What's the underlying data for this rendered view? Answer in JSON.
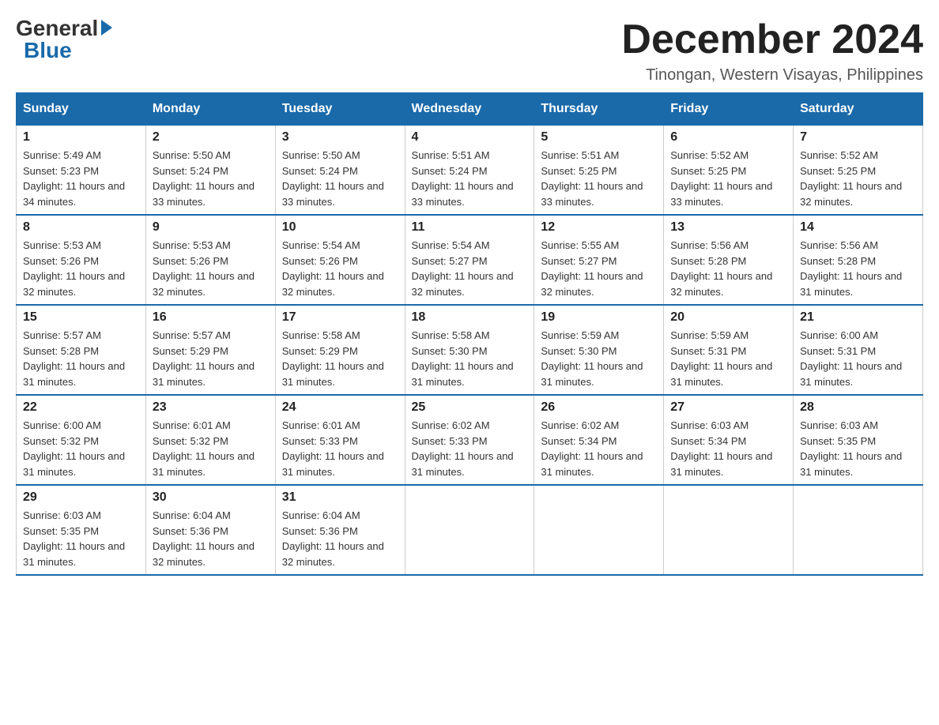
{
  "header": {
    "logo": {
      "general": "General",
      "blue": "Blue"
    },
    "title": "December 2024",
    "location": "Tinongan, Western Visayas, Philippines"
  },
  "calendar": {
    "days_of_week": [
      "Sunday",
      "Monday",
      "Tuesday",
      "Wednesday",
      "Thursday",
      "Friday",
      "Saturday"
    ],
    "weeks": [
      [
        {
          "day": "1",
          "sunrise": "5:49 AM",
          "sunset": "5:23 PM",
          "daylight": "11 hours and 34 minutes."
        },
        {
          "day": "2",
          "sunrise": "5:50 AM",
          "sunset": "5:24 PM",
          "daylight": "11 hours and 33 minutes."
        },
        {
          "day": "3",
          "sunrise": "5:50 AM",
          "sunset": "5:24 PM",
          "daylight": "11 hours and 33 minutes."
        },
        {
          "day": "4",
          "sunrise": "5:51 AM",
          "sunset": "5:24 PM",
          "daylight": "11 hours and 33 minutes."
        },
        {
          "day": "5",
          "sunrise": "5:51 AM",
          "sunset": "5:25 PM",
          "daylight": "11 hours and 33 minutes."
        },
        {
          "day": "6",
          "sunrise": "5:52 AM",
          "sunset": "5:25 PM",
          "daylight": "11 hours and 33 minutes."
        },
        {
          "day": "7",
          "sunrise": "5:52 AM",
          "sunset": "5:25 PM",
          "daylight": "11 hours and 32 minutes."
        }
      ],
      [
        {
          "day": "8",
          "sunrise": "5:53 AM",
          "sunset": "5:26 PM",
          "daylight": "11 hours and 32 minutes."
        },
        {
          "day": "9",
          "sunrise": "5:53 AM",
          "sunset": "5:26 PM",
          "daylight": "11 hours and 32 minutes."
        },
        {
          "day": "10",
          "sunrise": "5:54 AM",
          "sunset": "5:26 PM",
          "daylight": "11 hours and 32 minutes."
        },
        {
          "day": "11",
          "sunrise": "5:54 AM",
          "sunset": "5:27 PM",
          "daylight": "11 hours and 32 minutes."
        },
        {
          "day": "12",
          "sunrise": "5:55 AM",
          "sunset": "5:27 PM",
          "daylight": "11 hours and 32 minutes."
        },
        {
          "day": "13",
          "sunrise": "5:56 AM",
          "sunset": "5:28 PM",
          "daylight": "11 hours and 32 minutes."
        },
        {
          "day": "14",
          "sunrise": "5:56 AM",
          "sunset": "5:28 PM",
          "daylight": "11 hours and 31 minutes."
        }
      ],
      [
        {
          "day": "15",
          "sunrise": "5:57 AM",
          "sunset": "5:28 PM",
          "daylight": "11 hours and 31 minutes."
        },
        {
          "day": "16",
          "sunrise": "5:57 AM",
          "sunset": "5:29 PM",
          "daylight": "11 hours and 31 minutes."
        },
        {
          "day": "17",
          "sunrise": "5:58 AM",
          "sunset": "5:29 PM",
          "daylight": "11 hours and 31 minutes."
        },
        {
          "day": "18",
          "sunrise": "5:58 AM",
          "sunset": "5:30 PM",
          "daylight": "11 hours and 31 minutes."
        },
        {
          "day": "19",
          "sunrise": "5:59 AM",
          "sunset": "5:30 PM",
          "daylight": "11 hours and 31 minutes."
        },
        {
          "day": "20",
          "sunrise": "5:59 AM",
          "sunset": "5:31 PM",
          "daylight": "11 hours and 31 minutes."
        },
        {
          "day": "21",
          "sunrise": "6:00 AM",
          "sunset": "5:31 PM",
          "daylight": "11 hours and 31 minutes."
        }
      ],
      [
        {
          "day": "22",
          "sunrise": "6:00 AM",
          "sunset": "5:32 PM",
          "daylight": "11 hours and 31 minutes."
        },
        {
          "day": "23",
          "sunrise": "6:01 AM",
          "sunset": "5:32 PM",
          "daylight": "11 hours and 31 minutes."
        },
        {
          "day": "24",
          "sunrise": "6:01 AM",
          "sunset": "5:33 PM",
          "daylight": "11 hours and 31 minutes."
        },
        {
          "day": "25",
          "sunrise": "6:02 AM",
          "sunset": "5:33 PM",
          "daylight": "11 hours and 31 minutes."
        },
        {
          "day": "26",
          "sunrise": "6:02 AM",
          "sunset": "5:34 PM",
          "daylight": "11 hours and 31 minutes."
        },
        {
          "day": "27",
          "sunrise": "6:03 AM",
          "sunset": "5:34 PM",
          "daylight": "11 hours and 31 minutes."
        },
        {
          "day": "28",
          "sunrise": "6:03 AM",
          "sunset": "5:35 PM",
          "daylight": "11 hours and 31 minutes."
        }
      ],
      [
        {
          "day": "29",
          "sunrise": "6:03 AM",
          "sunset": "5:35 PM",
          "daylight": "11 hours and 31 minutes."
        },
        {
          "day": "30",
          "sunrise": "6:04 AM",
          "sunset": "5:36 PM",
          "daylight": "11 hours and 32 minutes."
        },
        {
          "day": "31",
          "sunrise": "6:04 AM",
          "sunset": "5:36 PM",
          "daylight": "11 hours and 32 minutes."
        },
        null,
        null,
        null,
        null
      ]
    ],
    "labels": {
      "sunrise": "Sunrise: ",
      "sunset": "Sunset: ",
      "daylight": "Daylight: "
    }
  }
}
